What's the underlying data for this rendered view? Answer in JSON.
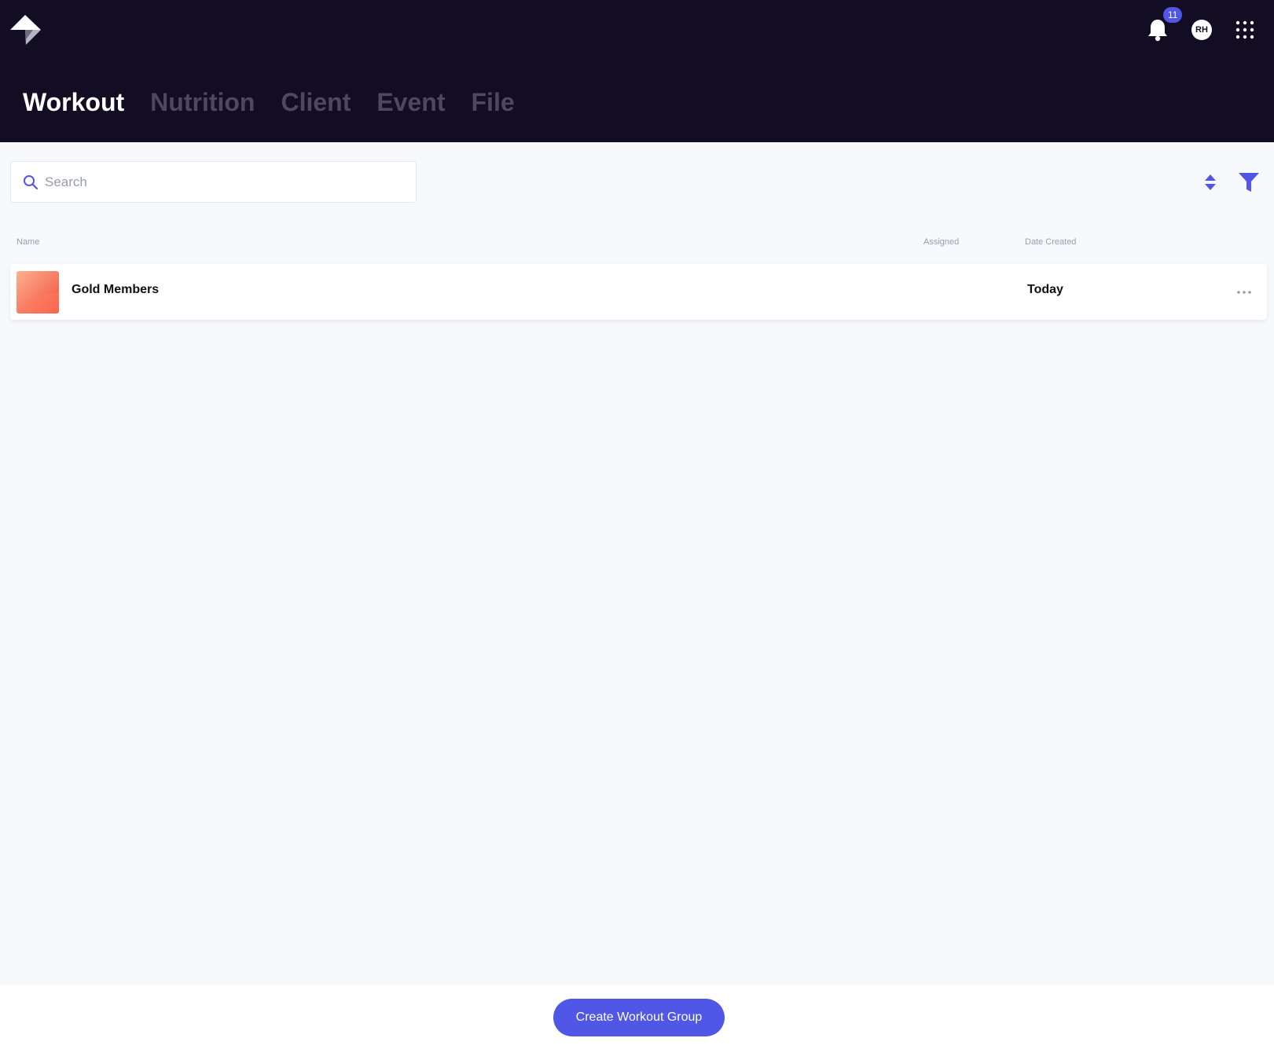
{
  "header": {
    "notifications_count": "11",
    "avatar_initials": "RH",
    "tabs": [
      {
        "label": "Workout",
        "active": true
      },
      {
        "label": "Nutrition",
        "active": false
      },
      {
        "label": "Client",
        "active": false
      },
      {
        "label": "Event",
        "active": false
      },
      {
        "label": "File",
        "active": false
      }
    ]
  },
  "icons": {
    "logo": "logo-icon",
    "notifications": "bell-icon",
    "apps": "grid-icon",
    "search": "search-icon",
    "sort": "sort-icon",
    "filter": "filter-icon",
    "row_menu": "more-horizontal-icon"
  },
  "search": {
    "placeholder": "Search",
    "value": ""
  },
  "table": {
    "columns": [
      "Name",
      "Assigned",
      "Date Created"
    ],
    "rows": [
      {
        "name": "Gold Members",
        "assigned": "",
        "date_created": "Today"
      }
    ]
  },
  "footer": {
    "create_label": "Create Workout Group"
  },
  "colors": {
    "header_bg": "#130d24",
    "accent": "#5056e6",
    "page_bg": "#f7f9fc",
    "thumb_start": "#ffa985",
    "thumb_end": "#f0503c"
  }
}
